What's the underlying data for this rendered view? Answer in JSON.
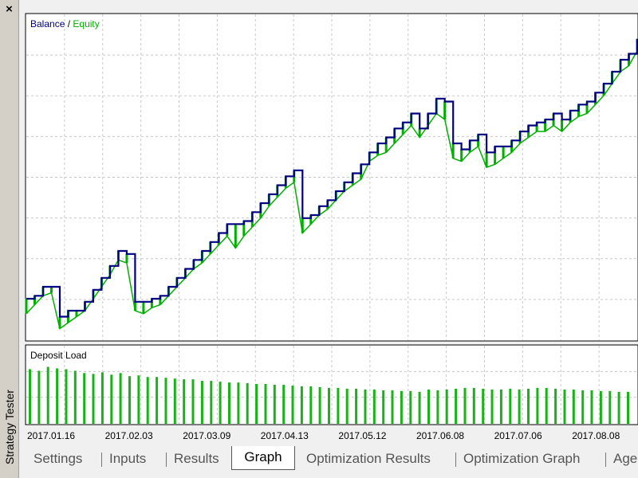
{
  "window": {
    "panel_title": "Strategy Tester",
    "close_glyph": "×",
    "close_icon": "close-icon"
  },
  "chart": {
    "legend": {
      "balance": "Balance",
      "separator": " / ",
      "equity": "Equity"
    },
    "colors": {
      "balance": "#000080",
      "equity": "#00b000",
      "deposit": "#19b319",
      "grid": "#c8c8c8",
      "legend_sep": "#000000"
    },
    "deposit_label": "Deposit Load",
    "dates": [
      "2017.01.16",
      "2017.02.03",
      "2017.03.09",
      "2017.04.13",
      "2017.05.12",
      "2017.06.08",
      "2017.07.06",
      "2017.08.08"
    ]
  },
  "chart_data": {
    "type": "line",
    "title": "",
    "legend_placement": "top-left",
    "grid": true,
    "x_tick_labels": [
      "2017.01.16",
      "2017.02.03",
      "2017.03.09",
      "2017.04.13",
      "2017.05.12",
      "2017.06.08",
      "2017.07.06",
      "2017.08.08"
    ],
    "y_range": [
      0,
      100
    ],
    "series": [
      {
        "name": "Balance",
        "values": [
          8,
          9,
          12,
          12,
          2,
          4,
          4,
          7,
          11,
          15,
          19,
          24,
          23,
          7,
          7,
          8,
          9,
          12,
          15,
          18,
          21,
          24,
          27,
          30,
          33,
          33,
          34,
          37,
          40,
          43,
          46,
          49,
          51,
          35,
          36,
          39,
          41,
          44,
          47,
          50,
          53,
          57,
          60,
          62,
          65,
          67,
          70,
          65,
          70,
          75,
          74,
          60,
          58,
          61,
          63,
          57,
          59,
          59,
          61,
          64,
          66,
          67,
          68,
          70,
          68,
          71,
          73,
          74,
          77,
          80,
          84,
          88,
          90,
          95
        ]
      },
      {
        "name": "Equity",
        "values": [
          3,
          6,
          9,
          10,
          -2,
          0,
          2,
          4,
          8,
          12,
          16,
          21,
          20,
          4,
          3,
          5,
          6,
          9,
          12,
          15,
          18,
          20,
          23,
          26,
          29,
          25,
          29,
          32,
          35,
          39,
          42,
          45,
          47,
          30,
          33,
          36,
          38,
          41,
          44,
          46,
          48,
          54,
          56,
          57,
          60,
          63,
          66,
          62,
          66,
          70,
          68,
          55,
          54,
          57,
          59,
          52,
          53,
          55,
          57,
          60,
          62,
          64,
          64,
          66,
          64,
          67,
          69,
          70,
          73,
          76,
          80,
          84,
          86,
          91
        ]
      },
      {
        "name": "Deposit Load",
        "values": [
          70,
          68,
          73,
          71,
          70,
          68,
          65,
          64,
          66,
          63,
          65,
          61,
          62,
          60,
          60,
          59,
          58,
          57,
          57,
          55,
          55,
          54,
          53,
          53,
          52,
          51,
          51,
          50,
          50,
          49,
          48,
          48,
          47,
          46,
          46,
          45,
          45,
          44,
          44,
          43,
          43,
          42,
          42,
          41,
          44,
          43,
          44,
          45,
          46,
          46,
          45,
          44,
          44,
          45,
          44,
          45,
          46,
          46,
          45,
          44,
          44,
          43,
          43,
          42,
          42,
          41,
          41
        ]
      }
    ]
  },
  "tabs": [
    {
      "label": "Settings",
      "active": false
    },
    {
      "label": "Inputs",
      "active": false
    },
    {
      "label": "Results",
      "active": false
    },
    {
      "label": "Graph",
      "active": true
    },
    {
      "label": "Optimization Results",
      "active": false
    },
    {
      "label": "Optimization Graph",
      "active": false
    },
    {
      "label": "Age",
      "active": false
    }
  ]
}
